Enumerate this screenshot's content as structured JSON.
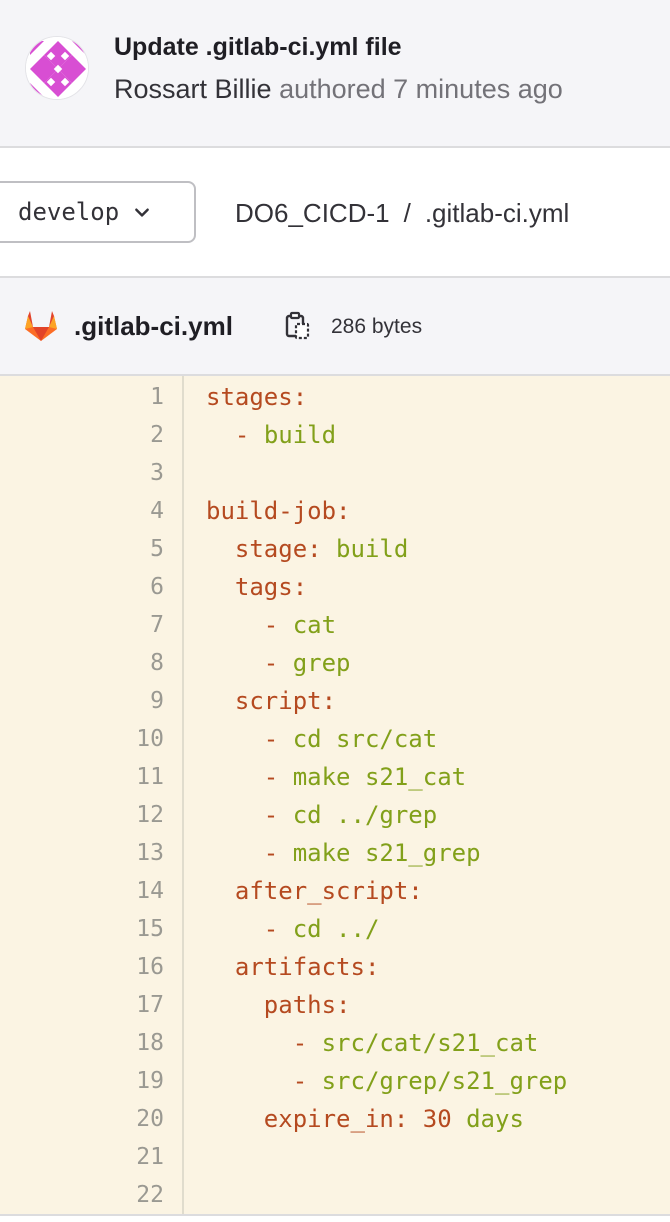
{
  "commit": {
    "title": "Update .gitlab-ci.yml file",
    "author": "Rossart Billie",
    "authored_text": "authored 7 minutes ago"
  },
  "branch": {
    "label": "develop",
    "icon": "chevron-down-icon"
  },
  "breadcrumb": {
    "project": "DO6_CICD-1",
    "separator": "/",
    "file": ".gitlab-ci.yml"
  },
  "file": {
    "name": ".gitlab-ci.yml",
    "size": "286 bytes",
    "icons": [
      "gitlab-logo-icon",
      "copy-path-icon"
    ]
  },
  "colors": {
    "code_background": "#fbf4e3",
    "yaml_key": "#b54a20",
    "yaml_value": "#82a01a",
    "avatar": "#d84ed3"
  },
  "code_lines": [
    {
      "n": "1",
      "indent": "",
      "dash": "",
      "key": "stages:",
      "val": ""
    },
    {
      "n": "2",
      "indent": "  ",
      "dash": "- ",
      "key": "",
      "val": "build"
    },
    {
      "n": "3",
      "indent": "",
      "dash": "",
      "key": "",
      "val": ""
    },
    {
      "n": "4",
      "indent": "",
      "dash": "",
      "key": "build-job:",
      "val": ""
    },
    {
      "n": "5",
      "indent": "  ",
      "dash": "",
      "key": "stage:",
      "val": " build"
    },
    {
      "n": "6",
      "indent": "  ",
      "dash": "",
      "key": "tags:",
      "val": ""
    },
    {
      "n": "7",
      "indent": "    ",
      "dash": "- ",
      "key": "",
      "val": "cat"
    },
    {
      "n": "8",
      "indent": "    ",
      "dash": "- ",
      "key": "",
      "val": "grep"
    },
    {
      "n": "9",
      "indent": "  ",
      "dash": "",
      "key": "script:",
      "val": ""
    },
    {
      "n": "10",
      "indent": "    ",
      "dash": "- ",
      "key": "",
      "val": "cd src/cat"
    },
    {
      "n": "11",
      "indent": "    ",
      "dash": "- ",
      "key": "",
      "val": "make s21_cat"
    },
    {
      "n": "12",
      "indent": "    ",
      "dash": "- ",
      "key": "",
      "val": "cd ../grep"
    },
    {
      "n": "13",
      "indent": "    ",
      "dash": "- ",
      "key": "",
      "val": "make s21_grep"
    },
    {
      "n": "14",
      "indent": "  ",
      "dash": "",
      "key": "after_script:",
      "val": ""
    },
    {
      "n": "15",
      "indent": "    ",
      "dash": "- ",
      "key": "",
      "val": "cd ../"
    },
    {
      "n": "16",
      "indent": "  ",
      "dash": "",
      "key": "artifacts:",
      "val": ""
    },
    {
      "n": "17",
      "indent": "    ",
      "dash": "",
      "key": "paths:",
      "val": ""
    },
    {
      "n": "18",
      "indent": "      ",
      "dash": "- ",
      "key": "",
      "val": "src/cat/s21_cat"
    },
    {
      "n": "19",
      "indent": "      ",
      "dash": "- ",
      "key": "",
      "val": "src/grep/s21_grep"
    },
    {
      "n": "20",
      "indent": "    ",
      "dash": "",
      "key": "expire_in:",
      "num": " 30",
      "val": " days"
    },
    {
      "n": "21",
      "indent": "",
      "dash": "",
      "key": "",
      "val": ""
    },
    {
      "n": "22",
      "indent": "",
      "dash": "",
      "key": "",
      "val": ""
    }
  ]
}
